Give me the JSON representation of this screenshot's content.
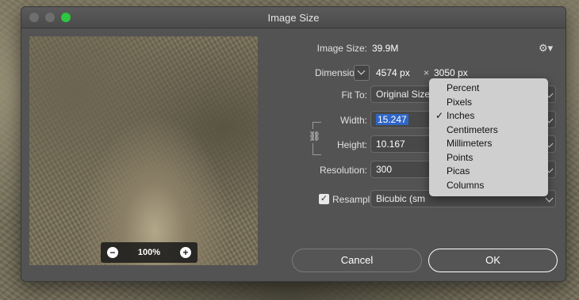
{
  "window": {
    "title": "Image Size"
  },
  "preview": {
    "zoom": "100%",
    "zoom_out": "−",
    "zoom_in": "+"
  },
  "image_size": {
    "label": "Image Size:",
    "value": "39.9M"
  },
  "dimensions": {
    "label": "Dimensions:",
    "width": "4574 px",
    "times": "×",
    "height": "3050 px"
  },
  "fit_to": {
    "label": "Fit To:",
    "value": "Original Size"
  },
  "width": {
    "label": "Width:",
    "value": "15.247"
  },
  "height": {
    "label": "Height:",
    "value": "10.167"
  },
  "resolution": {
    "label": "Resolution:",
    "value": "300"
  },
  "resample": {
    "label": "Resample:",
    "value": "Bicubic (sm"
  },
  "buttons": {
    "cancel": "Cancel",
    "ok": "OK"
  },
  "unit_menu": {
    "items": [
      "Percent",
      "Pixels",
      "Inches",
      "Centimeters",
      "Millimeters",
      "Points",
      "Picas",
      "Columns"
    ],
    "selected": "Inches",
    "check": "✓"
  },
  "icons": {
    "gear": "gear-icon",
    "link": "link-icon",
    "chevron": "chevron-down-icon"
  }
}
